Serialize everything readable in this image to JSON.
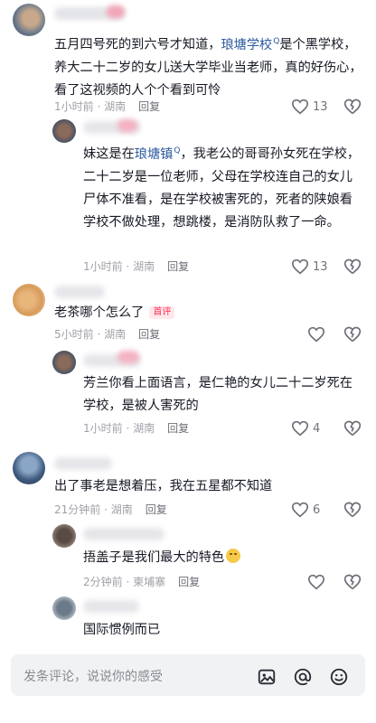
{
  "colors": {
    "link": "#2b5a9e",
    "badge": "#fe2c55",
    "meta": "#a0a0a8"
  },
  "comments": [
    {
      "text_parts": [
        "五月四号死的到六号才知道，",
        "琅塘学校",
        "是个黑学校，养大二十二岁的女儿送大学毕业当老师，真的好伤心，看了这视频的人个个看到可怜"
      ],
      "time": "1小时前 · 湖南",
      "reply": "回复",
      "likes": "13"
    },
    {
      "text_parts": [
        "妹这是在",
        "琅塘镇",
        "，我老公的哥哥孙女死在学校，二十二岁是一位老师，父母在学校连自己的女儿尸体不准看，是在学校被害死的，死者的陕娘看学校不做处理，想跳楼，是消防队救了一命。"
      ],
      "time": "1小时前 · 湖南",
      "reply": "回复",
      "likes": "13"
    },
    {
      "text": "老茶哪个怎么了",
      "badge": "首评",
      "time": "5小时前 · 湖南",
      "reply": "回复"
    },
    {
      "text": "芳兰你看上面语言，是仁艳的女儿二十二岁死在学校，是被人害死的",
      "time": "1小时前 · 湖南",
      "reply": "回复",
      "likes": "4"
    },
    {
      "text": "出了事老是想着压，我在五星都不知道",
      "time": "21分钟前 · 湖南",
      "reply": "回复",
      "likes": "6"
    },
    {
      "text": "捂盖子是我们最大的特色",
      "time": "2分钟前 · 柬埔寨",
      "reply": "回复"
    },
    {
      "text": "国际惯例而已"
    }
  ],
  "input": {
    "placeholder": "发条评论，说说你的感受"
  },
  "icons": {
    "image": "image-icon",
    "mention": "at-icon",
    "emoji": "emoji-icon",
    "like": "heart-icon",
    "dislike": "broken-heart-icon",
    "search": "search-link-icon"
  }
}
